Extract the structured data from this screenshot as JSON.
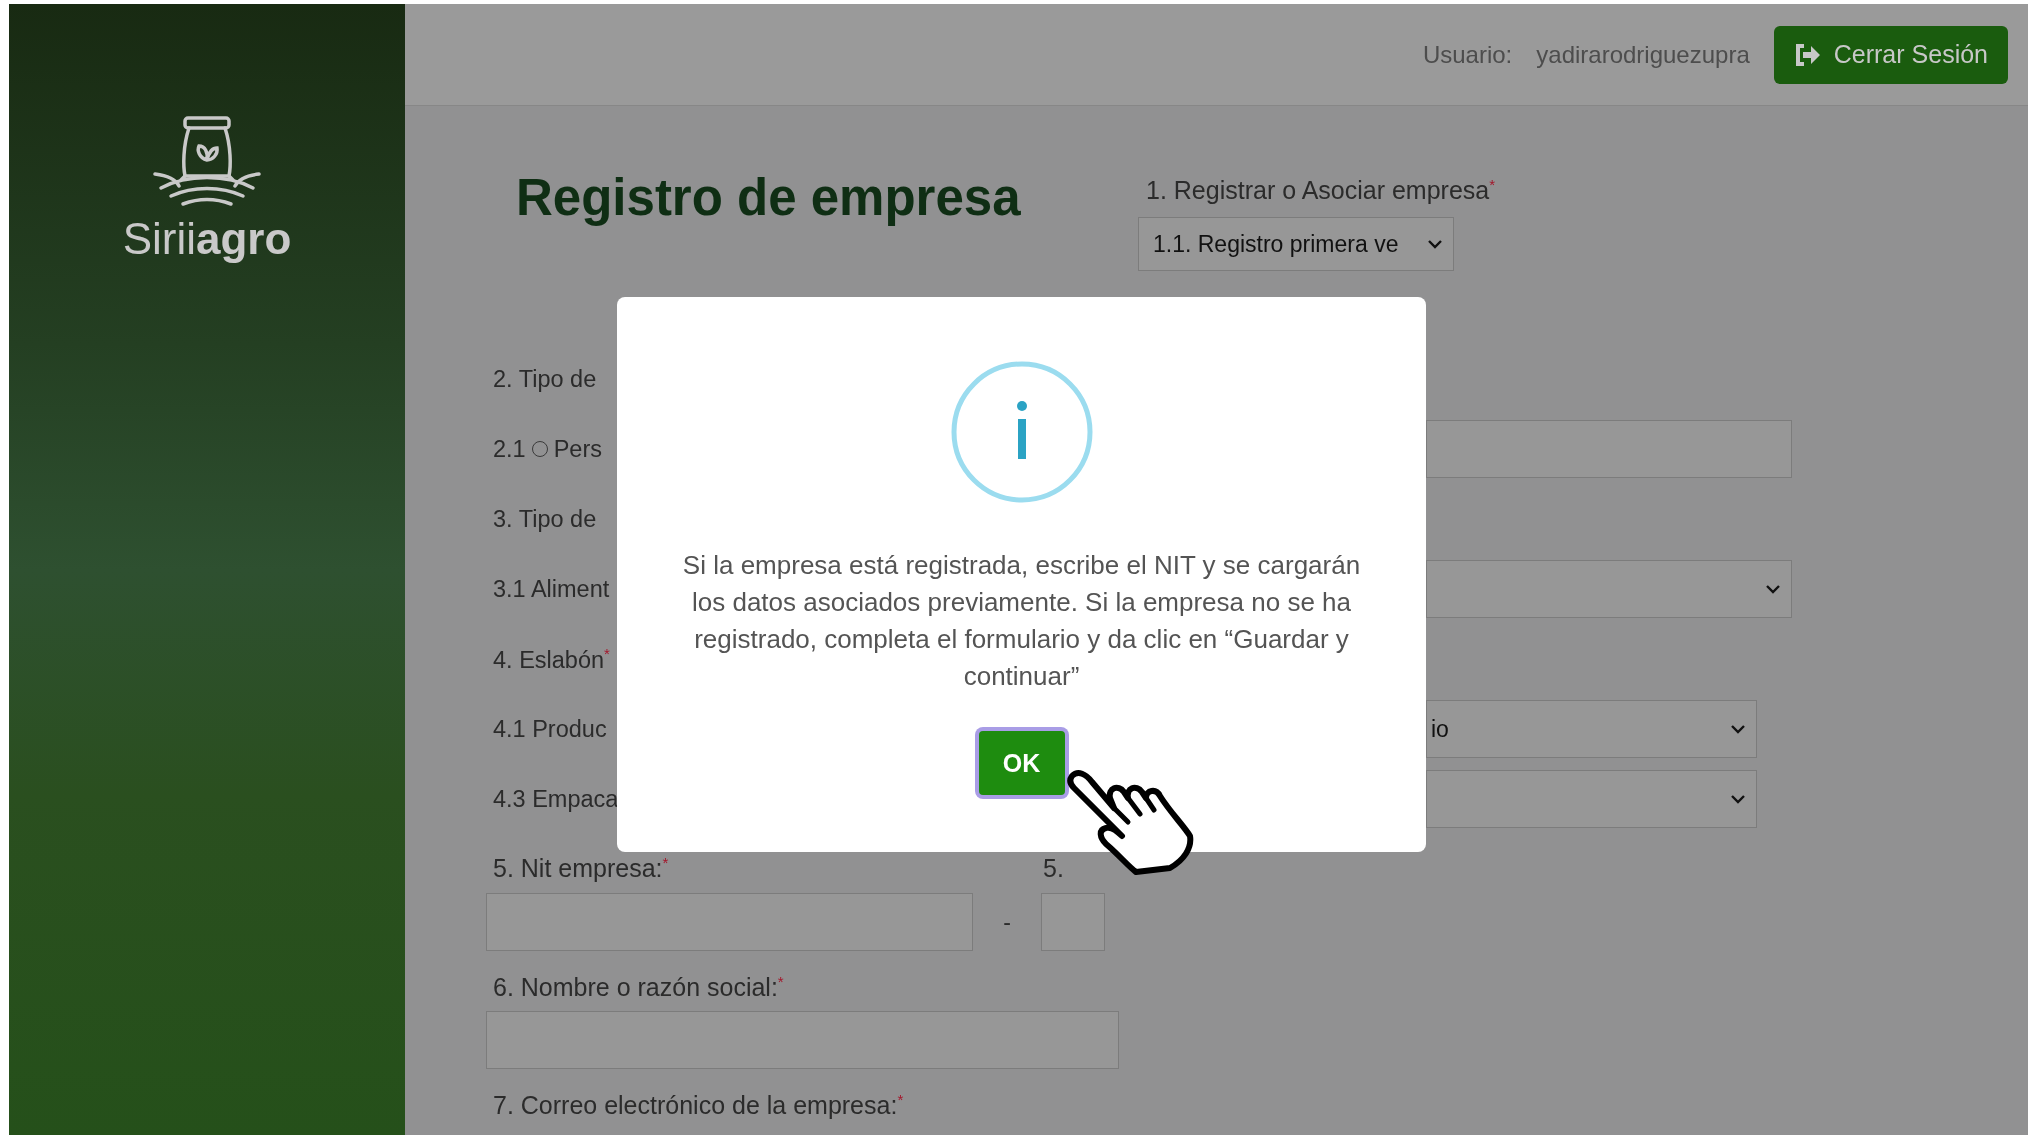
{
  "sidebar": {
    "logo_text": "Sirii**agro**"
  },
  "header": {
    "user_label": "Usuario:",
    "username": "yadirarodriguezupra",
    "logout_button": "Cerrar Sesión"
  },
  "form": {
    "title": "Registro de empresa",
    "company_mode": {
      "label": "1. Registrar o Asociar empresa$^{*}$",
      "value": "1.1. Registro primera ve"
    },
    "rows": [
      {
        "kind": "label",
        "text": "2. Tipo de"
      },
      {
        "kind": "radio",
        "number": "2.1",
        "text": "Pers",
        "checked": false,
        "field": {
          "kind": "input"
        }
      },
      {
        "kind": "label",
        "text": "3. Tipo de"
      },
      {
        "kind": "label",
        "text": "3.1 Aliment",
        "field": {
          "kind": "select"
        }
      },
      {
        "kind": "label",
        "text": "4. Eslabón$^{*}$"
      },
      {
        "kind": "label",
        "text": "4.1 Produc",
        "field": {
          "kind": "select",
          "value": "io"
        }
      },
      {
        "kind": "label",
        "text": "4.3 Empaca",
        "field": {
          "kind": "select"
        }
      }
    ],
    "nit": {
      "label": "5. Nit empresa:$^{*}$",
      "separator": "-",
      "check_label": "5."
    },
    "name": {
      "label": "6. Nombre o razón social:$^{*}$"
    },
    "email": {
      "label": "7. Correo electrónico de la empresa:$^{*}$"
    }
  },
  "dialog": {
    "message": "Si la empresa está registrada, escribe el NIT y se cargarán los datos asociados previamente. Si la empresa no se ha registrado, completa el formulario y da clic en “Guardar y continuar”",
    "button": "OK",
    "focused": true
  }
}
